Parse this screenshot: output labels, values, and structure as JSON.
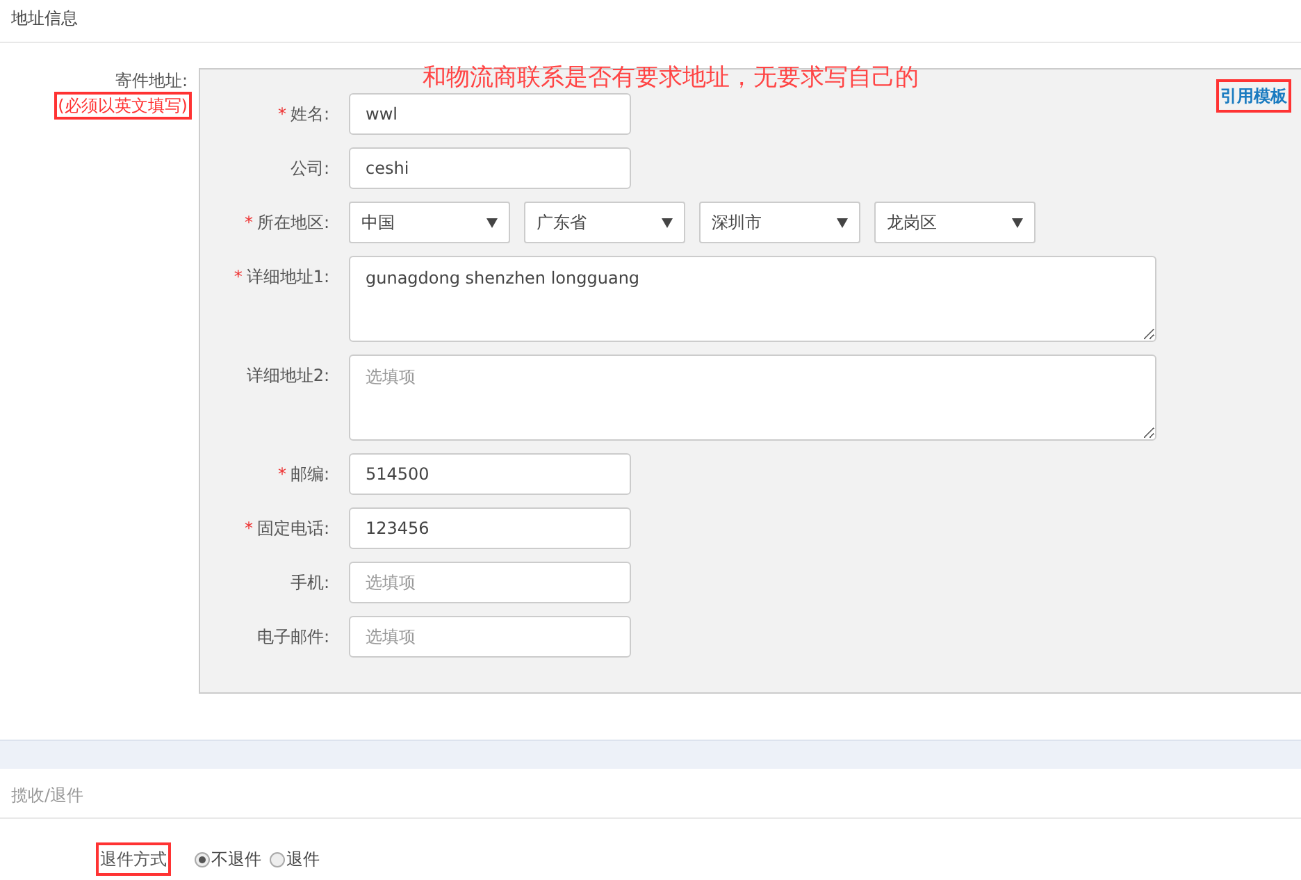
{
  "address_section": {
    "title": "地址信息",
    "sender_label": "寄件地址:",
    "sender_note": {
      "text": "(必须以英文填写)",
      "highlighted": true
    },
    "annotation": "和物流商联系是否有要求地址，无要求写自己的",
    "template_link": {
      "text": "引用模板",
      "highlighted": true
    },
    "fields": [
      {
        "kind": "text",
        "required_mark": "*",
        "label": "姓名:",
        "value": "wwl"
      },
      {
        "kind": "text",
        "label": "公司:",
        "value": "ceshi"
      },
      {
        "kind": "selects",
        "required_mark": "*",
        "label": "所在地区:",
        "options": [
          "中国",
          "广东省",
          "深圳市",
          "龙岗区"
        ]
      },
      {
        "kind": "textarea",
        "required_mark": "*",
        "label": "详细地址1:",
        "value": "gunagdong shenzhen longguang"
      },
      {
        "kind": "textarea",
        "label": "详细地址2:",
        "placeholder": "选填项"
      },
      {
        "kind": "text",
        "required_mark": "*",
        "label": "邮编:",
        "value": "514500"
      },
      {
        "kind": "text",
        "required_mark": "*",
        "label": "固定电话:",
        "value": "123456"
      },
      {
        "kind": "text",
        "label": "手机:",
        "placeholder": "选填项"
      },
      {
        "kind": "text",
        "label": "电子邮件:",
        "placeholder": "选填项"
      }
    ]
  },
  "return_section": {
    "title": "揽收/退件",
    "method_label": {
      "text": "退件方式",
      "highlighted": true
    },
    "options": [
      {
        "label": "不退件",
        "selected": true
      },
      {
        "label": "退件",
        "selected": false
      }
    ]
  }
}
